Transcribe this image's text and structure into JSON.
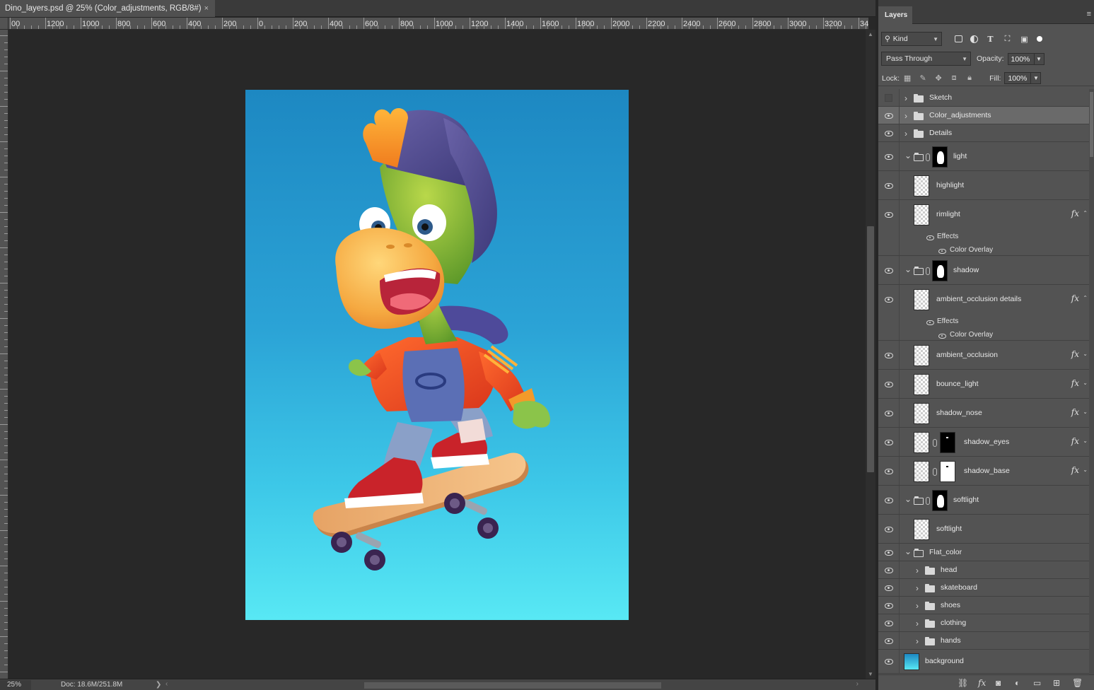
{
  "document": {
    "tab_title": "Dino_layers.psd @ 25% (Color_adjustments, RGB/8#)",
    "close_glyph": "×",
    "zoom": "25%",
    "doc_info": "Doc: 18.6M/251.8M",
    "ruler_labels": [
      "00",
      "1200",
      "1000",
      "800",
      "600",
      "400",
      "200",
      "0",
      "200",
      "400",
      "600",
      "800",
      "1000",
      "1200",
      "1400",
      "1600",
      "1800",
      "2000",
      "2200",
      "2400",
      "2600",
      "2800",
      "3000",
      "3200",
      "340"
    ],
    "canvas_colors": {
      "top": "#1d88c2",
      "bottom": "#58e8f4"
    }
  },
  "layers_panel": {
    "tab_label": "Layers",
    "menu_glyph": "≡",
    "filter": {
      "kind_label": "Kind",
      "icons": [
        "image-filter-icon",
        "adjustment-filter-icon",
        "type-filter-icon",
        "shape-filter-icon",
        "smart-object-filter-icon",
        "filter-toggle-icon"
      ]
    },
    "blend_mode": "Pass Through",
    "opacity_label": "Opacity:",
    "opacity_value": "100%",
    "lock_label": "Lock:",
    "lock_icons": [
      "lock-transparent-pixels-icon",
      "lock-image-pixels-icon",
      "lock-position-icon",
      "lock-artboard-icon",
      "lock-all-icon"
    ],
    "fill_label": "Fill:",
    "fill_value": "100%",
    "layers": [
      {
        "name": "Sketch",
        "kind": "group",
        "visible": false,
        "expanded": false,
        "indent": 0
      },
      {
        "name": "Color_adjustments",
        "kind": "group",
        "visible": true,
        "expanded": false,
        "indent": 0,
        "selected": true
      },
      {
        "name": "Details",
        "kind": "group",
        "visible": true,
        "expanded": false,
        "indent": 0
      },
      {
        "name": "light",
        "kind": "group-mask",
        "visible": true,
        "expanded": true,
        "indent": 0
      },
      {
        "name": "highlight",
        "kind": "pixel",
        "visible": true,
        "indent": 1
      },
      {
        "name": "rimlight",
        "kind": "pixel",
        "visible": true,
        "indent": 1,
        "fx": true,
        "effects": [
          "Effects",
          "Color Overlay"
        ]
      },
      {
        "name": "shadow",
        "kind": "group-mask",
        "visible": true,
        "expanded": true,
        "indent": 0
      },
      {
        "name": "ambient_occlusion details",
        "kind": "pixel",
        "visible": true,
        "indent": 1,
        "fx": true,
        "effects": [
          "Effects",
          "Color Overlay"
        ]
      },
      {
        "name": "ambient_occlusion",
        "kind": "pixel",
        "visible": true,
        "indent": 1,
        "fx": true
      },
      {
        "name": "bounce_light",
        "kind": "pixel",
        "visible": true,
        "indent": 1,
        "fx": true
      },
      {
        "name": "shadow_nose",
        "kind": "pixel",
        "visible": true,
        "indent": 1,
        "fx": true
      },
      {
        "name": "shadow_eyes",
        "kind": "pixel-mask-black",
        "visible": true,
        "indent": 1,
        "fx": true
      },
      {
        "name": "shadow_base",
        "kind": "pixel-mask-white",
        "visible": true,
        "indent": 1,
        "fx": true
      },
      {
        "name": "softlight",
        "kind": "group-mask",
        "visible": true,
        "expanded": true,
        "indent": 0
      },
      {
        "name": "softlight",
        "kind": "pixel",
        "visible": true,
        "indent": 1
      },
      {
        "name": "Flat_color",
        "kind": "group",
        "visible": true,
        "expanded": true,
        "indent": 0
      },
      {
        "name": "head",
        "kind": "group",
        "visible": true,
        "expanded": false,
        "indent": 1
      },
      {
        "name": "skateboard",
        "kind": "group",
        "visible": true,
        "expanded": false,
        "indent": 1
      },
      {
        "name": "shoes",
        "kind": "group",
        "visible": true,
        "expanded": false,
        "indent": 1
      },
      {
        "name": "clothing",
        "kind": "group",
        "visible": true,
        "expanded": false,
        "indent": 1
      },
      {
        "name": "hands",
        "kind": "group",
        "visible": true,
        "expanded": false,
        "indent": 1
      },
      {
        "name": "background",
        "kind": "background",
        "visible": true,
        "indent": 0
      }
    ],
    "footer_icons": [
      "link-layers-icon",
      "add-layer-style-icon",
      "add-mask-icon",
      "adjustment-layer-icon",
      "new-group-icon",
      "new-layer-icon",
      "delete-layer-icon"
    ]
  }
}
